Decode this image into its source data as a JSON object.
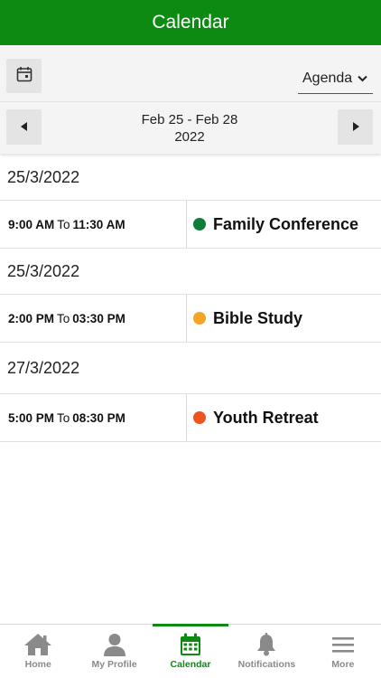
{
  "header": {
    "title": "Calendar"
  },
  "toolbar": {
    "calendar_icon": "calendar-icon",
    "view_select": {
      "selected": "Agenda",
      "icon": "chevron-down-icon"
    }
  },
  "range": {
    "line1": "Feb 25 - Feb 28",
    "line2": "2022",
    "prev_icon": "caret-left-icon",
    "next_icon": "caret-right-icon"
  },
  "agenda": [
    {
      "date": "25/3/2022",
      "start": "9:00 AM",
      "to": "To",
      "end": "11:30 AM",
      "title": "Family Conference",
      "color": "#0e7d3a"
    },
    {
      "date": "25/3/2022",
      "start": "2:00 PM",
      "to": "To",
      "end": "03:30 PM",
      "title": "Bible Study",
      "color": "#f2a623"
    },
    {
      "date": "27/3/2022",
      "start": "5:00 PM",
      "to": "To",
      "end": "08:30 PM",
      "title": "Youth Retreat",
      "color": "#ee5420"
    }
  ],
  "tabs": [
    {
      "label": "Home",
      "icon": "home-icon",
      "active": false
    },
    {
      "label": "My Profile",
      "icon": "user-icon",
      "active": false
    },
    {
      "label": "Calendar",
      "icon": "calendar-icon",
      "active": true
    },
    {
      "label": "Notifications",
      "icon": "bell-icon",
      "active": false
    },
    {
      "label": "More",
      "icon": "menu-icon",
      "active": false
    }
  ],
  "colors": {
    "brand": "#0c8a12",
    "inactive": "#8a8a8a"
  }
}
